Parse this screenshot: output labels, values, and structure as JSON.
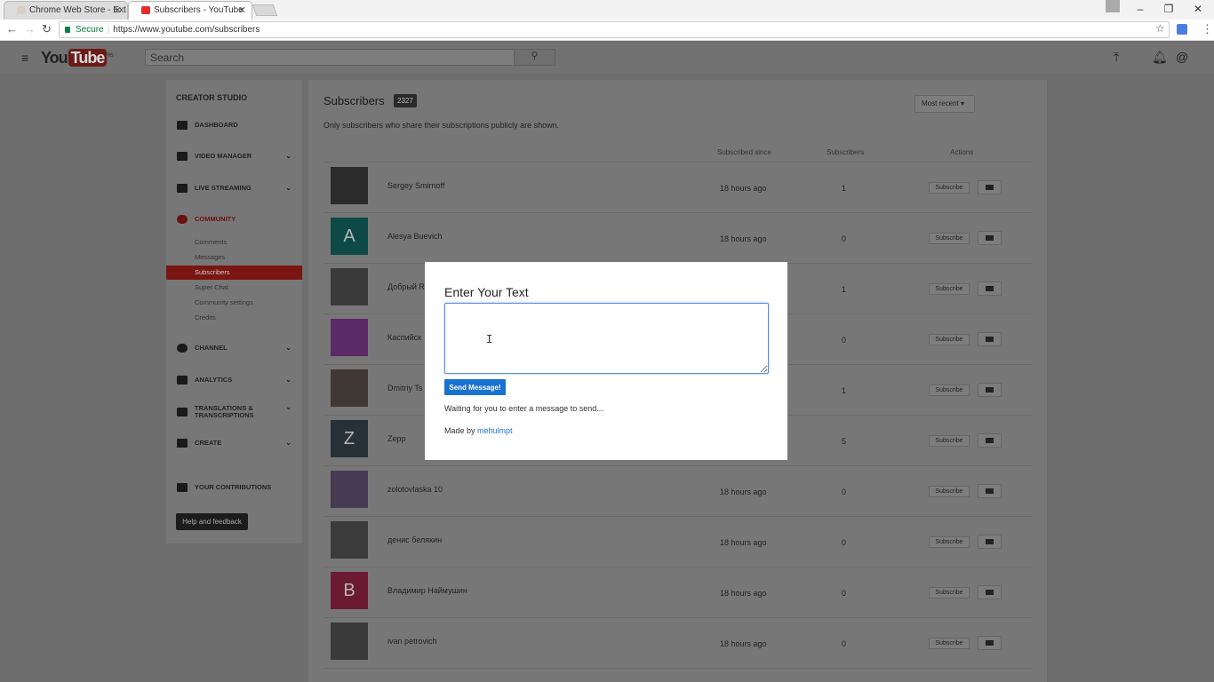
{
  "browser": {
    "tabs": [
      {
        "title": "Chrome Web Store - Ext",
        "active": false
      },
      {
        "title": "Subscribers - YouTube",
        "active": true
      }
    ],
    "secure_label": "Secure",
    "url": "https://www.youtube.com/subscribers"
  },
  "header": {
    "logo_you": "You",
    "logo_tube": "Tube",
    "logo_region": "RS",
    "search_placeholder": "Search"
  },
  "sidebar": {
    "title": "CREATOR STUDIO",
    "items": [
      {
        "label": "DASHBOARD"
      },
      {
        "label": "VIDEO MANAGER"
      },
      {
        "label": "LIVE STREAMING"
      },
      {
        "label": "COMMUNITY"
      },
      {
        "label": "CHANNEL"
      },
      {
        "label": "ANALYTICS"
      },
      {
        "label": "TRANSLATIONS &\nTRANSCRIPTIONS"
      },
      {
        "label": "CREATE"
      },
      {
        "label": "YOUR CONTRIBUTIONS"
      }
    ],
    "community_sub": [
      "Comments",
      "Messages",
      "Subscribers",
      "Super Chat",
      "Community settings",
      "Credits"
    ],
    "help_label": "Help and feedback"
  },
  "main": {
    "title": "Subscribers",
    "count": "2327",
    "subtitle": "Only subscribers who share their subscriptions publicly are shown.",
    "sort_label": "Most recent",
    "columns": {
      "since": "Subscribed since",
      "subscribers": "Subscribers",
      "actions": "Actions"
    },
    "rows": [
      {
        "name": "Sergey Smirnoff",
        "since": "18 hours ago",
        "subs": "1",
        "avatar": "",
        "color": "#2b2b2b"
      },
      {
        "name": "Alesya Buevich",
        "since": "18 hours ago",
        "subs": "0",
        "avatar": "A",
        "color": "#0d4a47"
      },
      {
        "name": "Добрый R",
        "since": "",
        "subs": "1",
        "avatar": "",
        "color": "#3a3a3a"
      },
      {
        "name": "Каспийск",
        "since": "",
        "subs": "0",
        "avatar": "",
        "color": "#5b2a66"
      },
      {
        "name": "Dmitriy Ts",
        "since": "",
        "subs": "1",
        "avatar": "",
        "color": "#3f3834"
      },
      {
        "name": "Zepp",
        "since": "",
        "subs": "5",
        "avatar": "Z",
        "color": "#263238"
      },
      {
        "name": "zolotovlaska 10",
        "since": "18 hours ago",
        "subs": "0",
        "avatar": "",
        "color": "#463b52"
      },
      {
        "name": "денис белякин",
        "since": "18 hours ago",
        "subs": "0",
        "avatar": "",
        "color": "#3b3b3b"
      },
      {
        "name": "Владимир Наймушин",
        "since": "18 hours ago",
        "subs": "0",
        "avatar": "B",
        "color": "#6b1a33"
      },
      {
        "name": "ivan petrovich",
        "since": "18 hours ago",
        "subs": "0",
        "avatar": "",
        "color": "#3a3a3a"
      }
    ],
    "subscribe_label": "Subscribe"
  },
  "modal": {
    "title": "Enter Your Text",
    "textarea_value": "",
    "send_label": "Send Message!",
    "status": "Waiting for you to enter a message to send...",
    "credit_prefix": "Made by",
    "credit_link": "mehulmpt"
  }
}
